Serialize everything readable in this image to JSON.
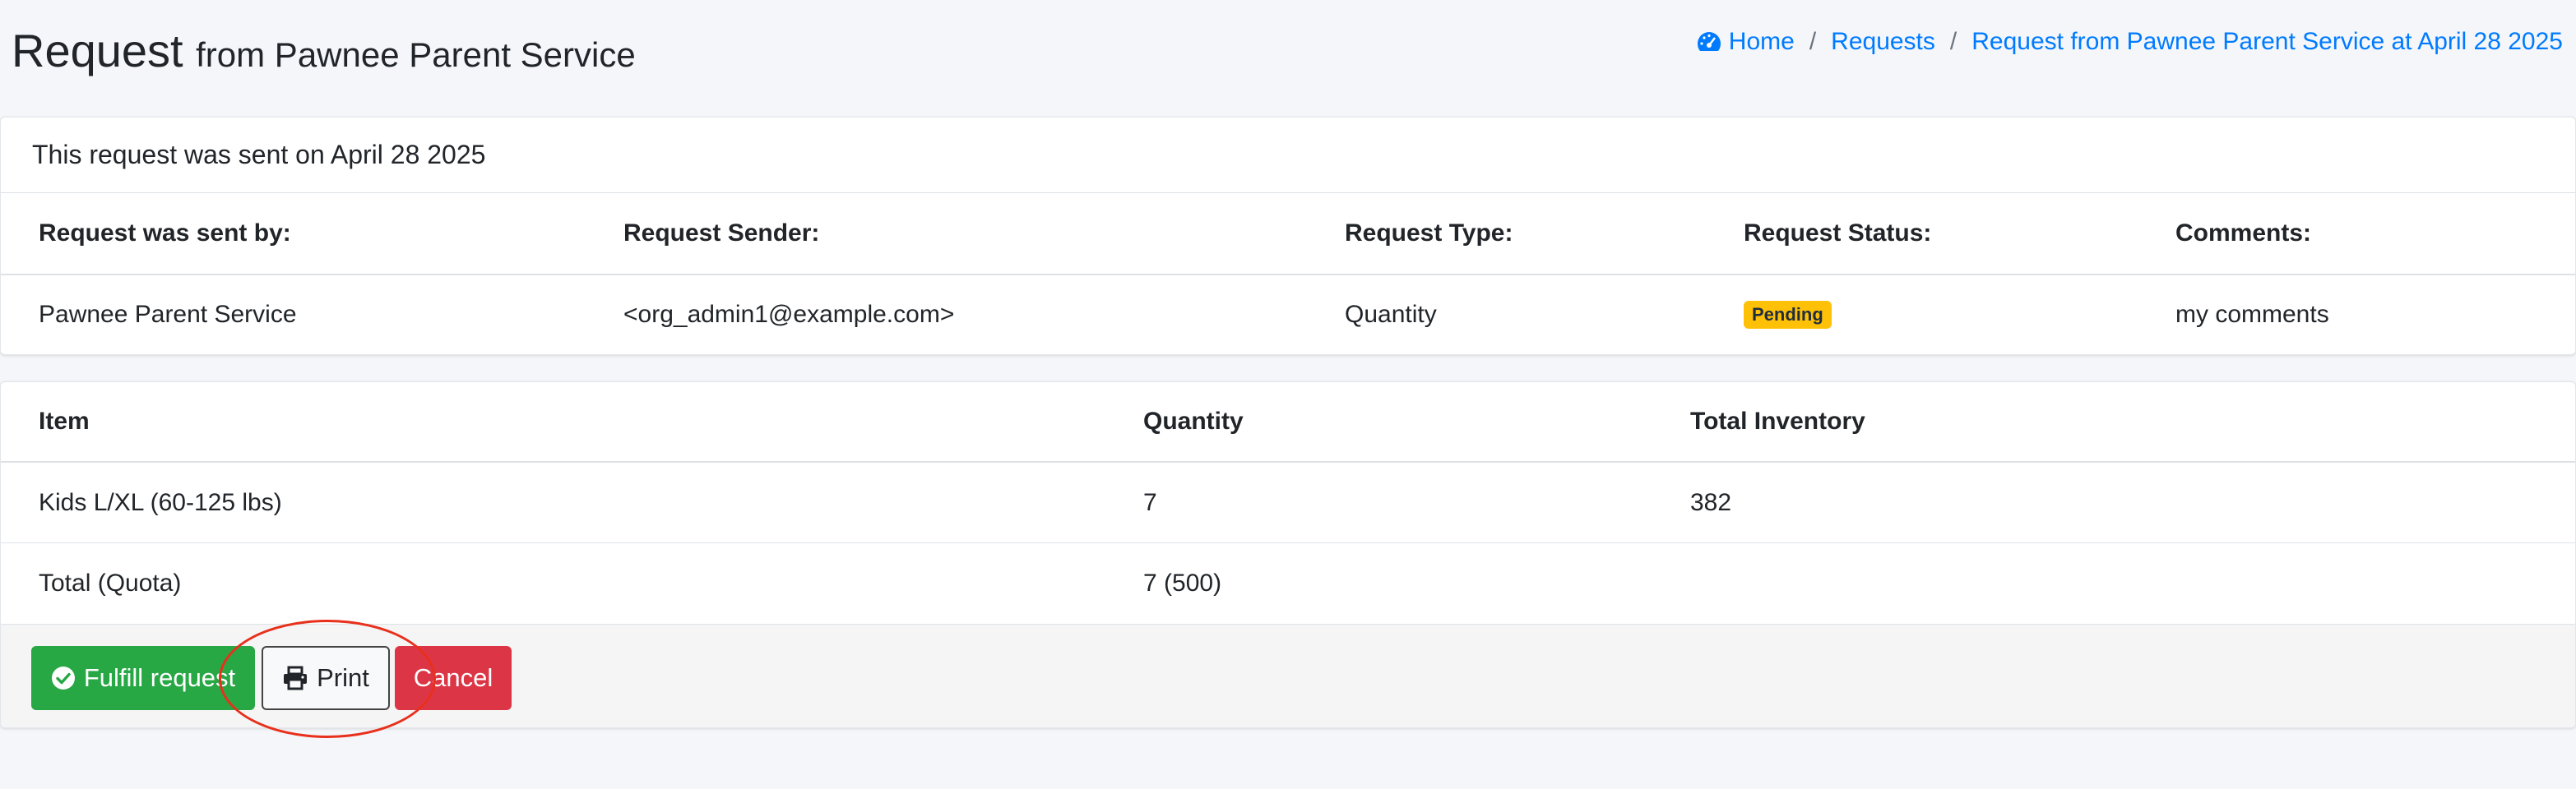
{
  "header": {
    "title_main": "Request",
    "title_sub": "from Pawnee Parent Service"
  },
  "breadcrumb": {
    "icon": "tachometer-icon",
    "items": [
      {
        "label": "Home"
      },
      {
        "label": "Requests"
      },
      {
        "label": "Request from Pawnee Parent Service at April 28 2025"
      }
    ],
    "separator": "/"
  },
  "summary": {
    "sent_text": "This request was sent on April 28 2025",
    "headers": [
      "Request was sent by:",
      "Request Sender:",
      "Request Type:",
      "Request Status:",
      "Comments:"
    ],
    "values": {
      "sent_by": "Pawnee Parent Service",
      "sender": "<org_admin1@example.com>",
      "type": "Quantity",
      "status": "Pending",
      "comments": "my comments"
    },
    "status_color": "#ffc107"
  },
  "items_table": {
    "headers": [
      "Item",
      "Quantity",
      "Total Inventory"
    ],
    "rows": [
      [
        "Kids L/XL (60-125 lbs)",
        "7",
        "382"
      ],
      [
        "Total (Quota)",
        "7 (500)",
        ""
      ]
    ]
  },
  "actions": {
    "fulfill_label": "Fulfill request",
    "print_label": "Print",
    "cancel_label": "Cancel",
    "colors": {
      "success": "#28a745",
      "danger": "#dc3545"
    }
  }
}
